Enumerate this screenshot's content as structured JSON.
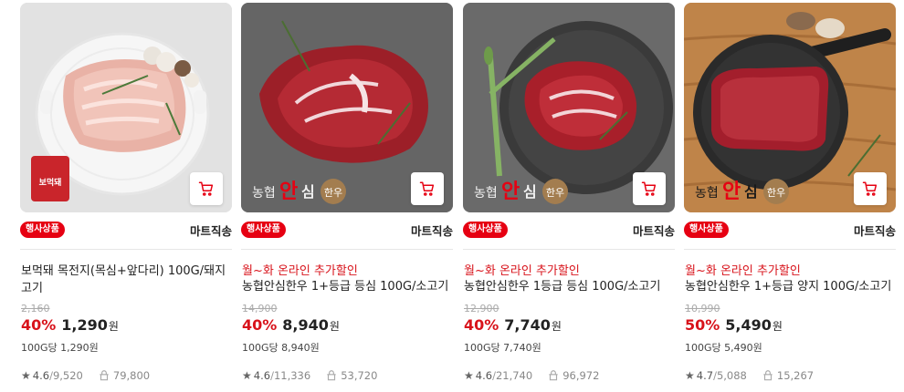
{
  "products": [
    {
      "badge": "행사상품",
      "delivery": "마트직송",
      "promo": "",
      "title": "보먹돼 목전지(목심+앞다리) 100G/돼지고기",
      "original_price": "2,160",
      "discount": "40%",
      "price": "1,290",
      "currency": "원",
      "unit_price": "100G당 1,290원",
      "rating": "4.6",
      "review_count": "9,520",
      "purchase_count": "79,800",
      "image_label": "보먹돼"
    },
    {
      "badge": "행사상품",
      "delivery": "마트직송",
      "promo": "월~화 온라인 추가할인",
      "title": "농협안심한우 1+등급 등심 100G/소고기",
      "original_price": "14,900",
      "discount": "40%",
      "price": "8,940",
      "currency": "원",
      "unit_price": "100G당 8,940원",
      "rating": "4.6",
      "review_count": "11,336",
      "purchase_count": "53,720",
      "image_label": "농협안심한우"
    },
    {
      "badge": "행사상품",
      "delivery": "마트직송",
      "promo": "월~화 온라인 추가할인",
      "title": "농협안심한우 1등급 등심 100G/소고기",
      "original_price": "12,900",
      "discount": "40%",
      "price": "7,740",
      "currency": "원",
      "unit_price": "100G당 7,740원",
      "rating": "4.6",
      "review_count": "21,740",
      "purchase_count": "96,972",
      "image_label": "농협안심한우"
    },
    {
      "badge": "행사상품",
      "delivery": "마트직송",
      "promo": "월~화 온라인 추가할인",
      "title": "농협안심한우 1+등급 양지 100G/소고기",
      "original_price": "10,990",
      "discount": "50%",
      "price": "5,490",
      "currency": "원",
      "unit_price": "100G당 5,490원",
      "rating": "4.7",
      "review_count": "5,088",
      "purchase_count": "15,267",
      "image_label": "농협안심한우"
    }
  ],
  "colors": {
    "accent_red": "#d8131b",
    "badge_red": "#e60012"
  },
  "icons": {
    "cart": "cart-icon",
    "star": "star-icon",
    "purchase": "purchase-count-icon"
  }
}
